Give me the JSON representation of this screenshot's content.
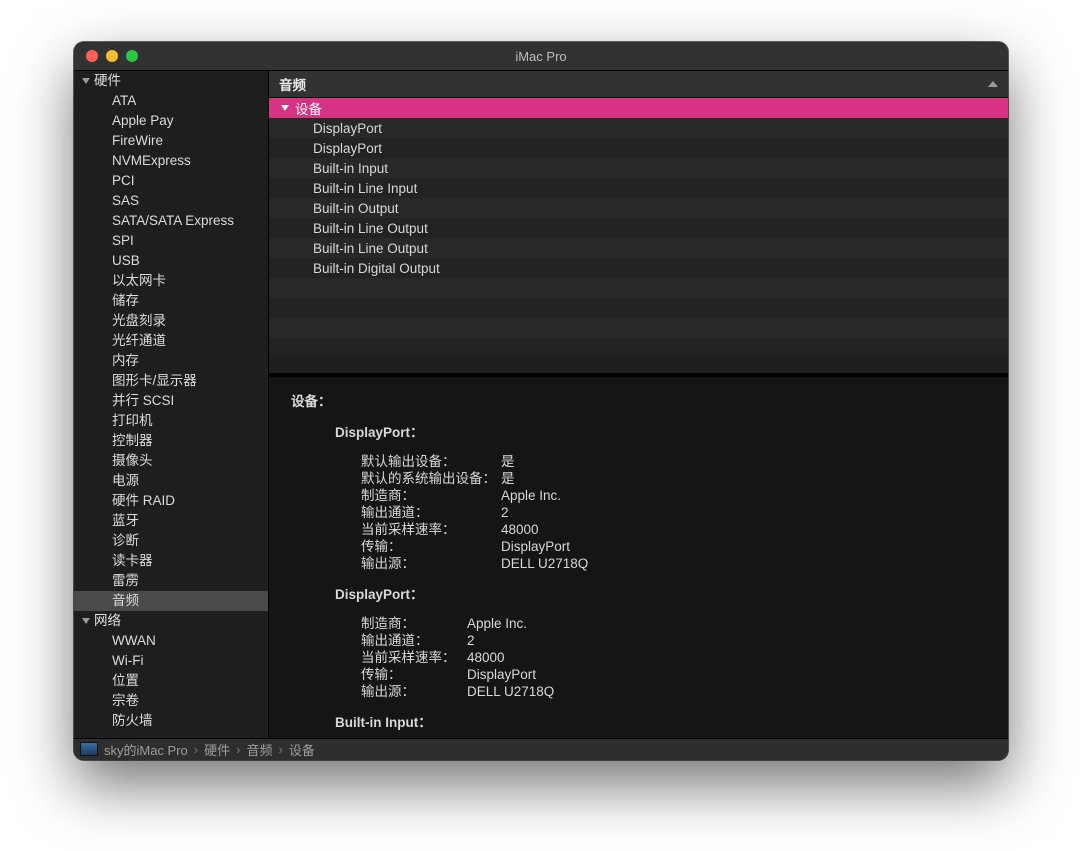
{
  "window": {
    "title": "iMac Pro"
  },
  "sidebar": {
    "sections": [
      {
        "label": "硬件",
        "items": [
          {
            "label": "ATA"
          },
          {
            "label": "Apple Pay"
          },
          {
            "label": "FireWire"
          },
          {
            "label": "NVMExpress"
          },
          {
            "label": "PCI"
          },
          {
            "label": "SAS"
          },
          {
            "label": "SATA/SATA Express"
          },
          {
            "label": "SPI"
          },
          {
            "label": "USB"
          },
          {
            "label": "以太网卡"
          },
          {
            "label": "储存"
          },
          {
            "label": "光盘刻录"
          },
          {
            "label": "光纤通道"
          },
          {
            "label": "内存"
          },
          {
            "label": "图形卡/显示器"
          },
          {
            "label": "并行 SCSI"
          },
          {
            "label": "打印机"
          },
          {
            "label": "控制器"
          },
          {
            "label": "摄像头"
          },
          {
            "label": "电源"
          },
          {
            "label": "硬件 RAID"
          },
          {
            "label": "蓝牙"
          },
          {
            "label": "诊断"
          },
          {
            "label": "读卡器"
          },
          {
            "label": "雷雳"
          },
          {
            "label": "音频",
            "selected": true
          }
        ]
      },
      {
        "label": "网络",
        "items": [
          {
            "label": "WWAN"
          },
          {
            "label": "Wi-Fi"
          },
          {
            "label": "位置"
          },
          {
            "label": "宗卷"
          },
          {
            "label": "防火墙"
          }
        ]
      }
    ]
  },
  "panel": {
    "header": "音频",
    "group_label": "设备",
    "devices": [
      "DisplayPort",
      "DisplayPort",
      "Built-in Input",
      "Built-in Line Input",
      "Built-in Output",
      "Built-in Line Output",
      "Built-in Line Output",
      "Built-in Digital Output"
    ]
  },
  "detail": {
    "heading": "设备：",
    "sections": [
      {
        "title": "DisplayPort：",
        "kv_width": "wide",
        "rows": [
          {
            "k": "默认输出设备：",
            "v": "是"
          },
          {
            "k": "默认的系统输出设备：",
            "v": "是"
          },
          {
            "k": "制造商：",
            "v": "Apple Inc."
          },
          {
            "k": "输出通道：",
            "v": "2"
          },
          {
            "k": "当前采样速率：",
            "v": "48000"
          },
          {
            "k": "传输：",
            "v": "DisplayPort"
          },
          {
            "k": "输出源：",
            "v": "DELL U2718Q"
          }
        ]
      },
      {
        "title": "DisplayPort：",
        "kv_width": "narrow",
        "rows": [
          {
            "k": "制造商：",
            "v": "Apple Inc."
          },
          {
            "k": "输出通道：",
            "v": "2"
          },
          {
            "k": "当前采样速率：",
            "v": "48000"
          },
          {
            "k": "传输：",
            "v": "DisplayPort"
          },
          {
            "k": "输出源：",
            "v": "DELL U2718Q"
          }
        ]
      },
      {
        "title": "Built-in Input：",
        "kv_width": "narrow",
        "rows": []
      }
    ]
  },
  "breadcrumb": [
    "sky的iMac Pro",
    "硬件",
    "音频",
    "设备"
  ]
}
